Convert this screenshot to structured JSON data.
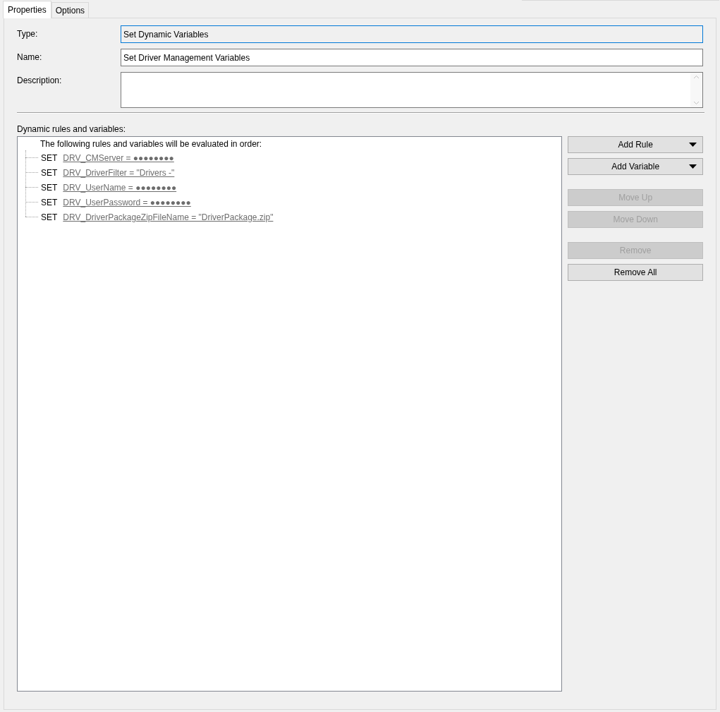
{
  "tabs": [
    {
      "label": "Properties",
      "selected": true
    },
    {
      "label": "Options",
      "selected": false
    }
  ],
  "fields": [
    {
      "label": "Type:",
      "value": "Set Dynamic Variables",
      "kind": "text",
      "focused": true,
      "readonly": true
    },
    {
      "label": "Name:",
      "value": "Set Driver Management Variables",
      "kind": "text",
      "focused": false,
      "readonly": false
    },
    {
      "label": "Description:",
      "kind": "multiline",
      "focused": false,
      "readonly": false
    }
  ],
  "rules": {
    "label": "Dynamic rules and variables:",
    "header": "The following rules and variables will be evaluated in order:",
    "items": [
      {
        "keyword": "SET",
        "text": "DRV_CMServer = ●●●●●●●●"
      },
      {
        "keyword": "SET",
        "text": "DRV_DriverFilter = \"Drivers -\""
      },
      {
        "keyword": "SET",
        "text": "DRV_UserName = ●●●●●●●●"
      },
      {
        "keyword": "SET",
        "text": "DRV_UserPassword = ●●●●●●●●"
      },
      {
        "keyword": "SET",
        "text": "DRV_DriverPackageZipFileName = \"DriverPackage.zip\""
      }
    ]
  },
  "button_groups": [
    [
      {
        "label": "Add Rule",
        "dropdown": true,
        "disabled": false
      },
      {
        "label": "Add Variable",
        "dropdown": true,
        "disabled": false
      }
    ],
    [
      {
        "label": "Move Up",
        "dropdown": false,
        "disabled": true
      },
      {
        "label": "Move Down",
        "dropdown": false,
        "disabled": true
      }
    ],
    [
      {
        "label": "Remove",
        "dropdown": false,
        "disabled": true
      },
      {
        "label": "Remove All",
        "dropdown": false,
        "disabled": false
      }
    ]
  ]
}
